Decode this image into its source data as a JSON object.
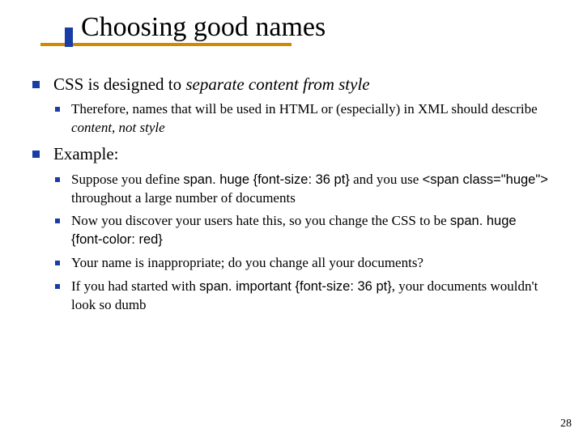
{
  "title": "Choosing good names",
  "p1_a": "CSS is designed to ",
  "p1_b": "separate content from style",
  "p1s1_a": "Therefore, names that will be used in HTML or (especially) in XML should describe ",
  "p1s1_b": "content, not style",
  "p2": "Example:",
  "p2s1_a": "Suppose you define ",
  "p2s1_b": "span. huge {font-size: 36 pt}",
  "p2s1_c": " and you use ",
  "p2s1_d": "<span class=\"huge\">",
  "p2s1_e": " throughout a large number of documents",
  "p2s2_a": "Now you discover your users hate this, so you change the CSS to be ",
  "p2s2_b": "span. huge {font-color: red}",
  "p2s3": "Your name is inappropriate; do you change all your documents?",
  "p2s4_a": "If you had started with ",
  "p2s4_b": "span. important {font-size: 36 pt}",
  "p2s4_c": ", your documents wouldn't look so dumb",
  "page_number": "28"
}
